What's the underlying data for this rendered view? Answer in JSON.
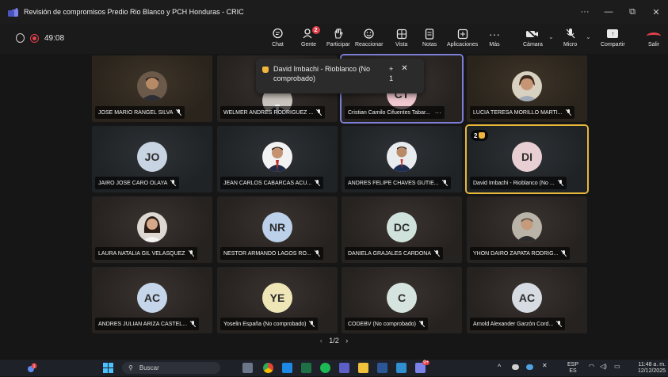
{
  "window": {
    "title": "Revisión de compromisos Predio Rio Blanco y PCH Honduras - CRIC",
    "controls": [
      "···",
      "—",
      "⧉",
      "✕"
    ]
  },
  "meeting": {
    "timer": "49:08"
  },
  "toolbar": {
    "chat": "Chat",
    "people": "Gente",
    "people_badge": "2",
    "raise": "Participar",
    "react": "Reaccionar",
    "view": "Vista",
    "notes": "Notas",
    "apps": "Aplicaciones",
    "more": "Más",
    "camera": "Cámara",
    "mic": "Micro",
    "share": "Compartir",
    "leave": "Salir"
  },
  "colors": {
    "active_outline": "#7d7fd6",
    "raised_outline": "#e7b83a",
    "leave": "#e0404a"
  },
  "popup": {
    "text": "David Imbachi - Rioblanco (No comprobado)",
    "plus": "+",
    "count": "1"
  },
  "tiles": [
    {
      "name": "JOSE MARIO RANGEL SILVA",
      "kind": "photo",
      "icon": "person-photo"
    },
    {
      "name": "WELMER ANDRES RODRIGUEZ ...",
      "kind": "photo",
      "icon": "person-photo"
    },
    {
      "name": "Cristian Camilo Cifuentes Tabar...",
      "kind": "initials",
      "initials": "CT",
      "more": "···"
    },
    {
      "name": "LUCIA TERESA MORILLO MARTI...",
      "kind": "photo",
      "icon": "person-photo"
    },
    {
      "name": "JAIRO JOSE CARO OLAYA",
      "kind": "initials",
      "initials": "JO",
      "color": "#c9d4e2"
    },
    {
      "name": "JEAN CARLOS CABARCAS ACU...",
      "kind": "photo",
      "icon": "person-photo"
    },
    {
      "name": "ANDRES FELIPE CHAVES GUTIE...",
      "kind": "photo",
      "icon": "person-photo"
    },
    {
      "name": "David Imbachi - Rioblanco (No ...",
      "kind": "initials",
      "initials": "DI",
      "color": "#e8cfd3",
      "hand_count": "2"
    },
    {
      "name": "LAURA NATALIA GIL VELASQUEZ",
      "kind": "photo",
      "icon": "person-photo"
    },
    {
      "name": "NESTOR ARMANDO LAGOS RO...",
      "kind": "initials",
      "initials": "NR",
      "color": "#bcd0ea"
    },
    {
      "name": "DANIELA GRAJALES CARDONA",
      "kind": "initials",
      "initials": "DC",
      "color": "#cfe3dc"
    },
    {
      "name": "YHON DAIRO ZAPATA RODRIG...",
      "kind": "photo",
      "icon": "person-photo"
    },
    {
      "name": "ANDRES JULIAN ARIZA CASTEL...",
      "kind": "initials",
      "initials": "AC",
      "color": "#c6d6ea"
    },
    {
      "name": "Yoselin España (No comprobado)",
      "kind": "initials",
      "initials": "YE",
      "color": "#efe6b8"
    },
    {
      "name": "CODEBV (No comprobado)",
      "kind": "initials",
      "initials": "C",
      "color": "#d5e4df"
    },
    {
      "name": "Arnold Alexander Garzón Cord...",
      "kind": "initials",
      "initials": "AC",
      "color": "#d7dce3"
    }
  ],
  "pager": {
    "prev": "‹",
    "label": "1/2",
    "next": "›"
  },
  "taskbar": {
    "search": "Buscar",
    "lang_top": "ESP",
    "lang_bottom": "ES",
    "time": "11:48 a. m.",
    "date": "12/12/2025",
    "teams_badge": "9+",
    "notif_badge": "1"
  }
}
